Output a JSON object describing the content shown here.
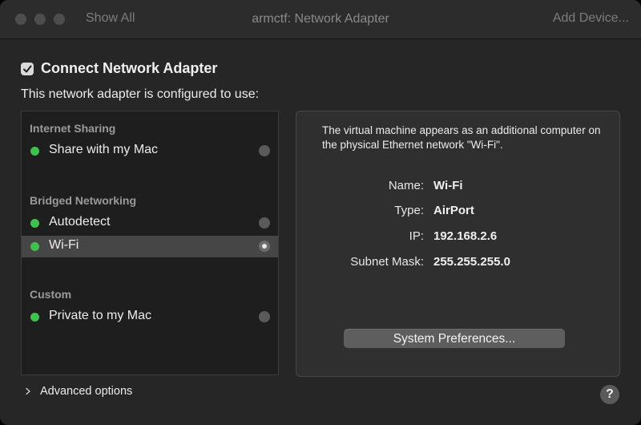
{
  "titlebar": {
    "show_all": "Show All",
    "title": "armctf: Network Adapter",
    "add_device": "Add Device..."
  },
  "connect": {
    "checked": true,
    "label": "Connect Network Adapter"
  },
  "configured_text": "This network adapter is configured to use:",
  "adapter_list": {
    "sections": [
      {
        "header": "Internet Sharing",
        "items": [
          {
            "label": "Share with my Mac",
            "selected": false,
            "status": "connected"
          }
        ]
      },
      {
        "header": "Bridged Networking",
        "items": [
          {
            "label": "Autodetect",
            "selected": false,
            "status": "connected"
          },
          {
            "label": "Wi-Fi",
            "selected": true,
            "status": "connected"
          }
        ]
      },
      {
        "header": "Custom",
        "items": [
          {
            "label": "Private to my Mac",
            "selected": false,
            "status": "connected"
          }
        ]
      }
    ]
  },
  "detail": {
    "description": "The virtual machine appears as an additional computer on the physical Ethernet network \"Wi-Fi\".",
    "fields": [
      {
        "label": "Name:",
        "value": "Wi-Fi"
      },
      {
        "label": "Type:",
        "value": "AirPort"
      },
      {
        "label": "IP:",
        "value": "192.168.2.6"
      },
      {
        "label": "Subnet Mask:",
        "value": "255.255.255.0"
      }
    ],
    "button_label": "System Preferences..."
  },
  "advanced": {
    "label": "Advanced options",
    "expanded": false
  },
  "help_label": "?",
  "colors": {
    "status_dot": "#3fc24d",
    "selection": "#464646",
    "window_bg": "#262626"
  }
}
